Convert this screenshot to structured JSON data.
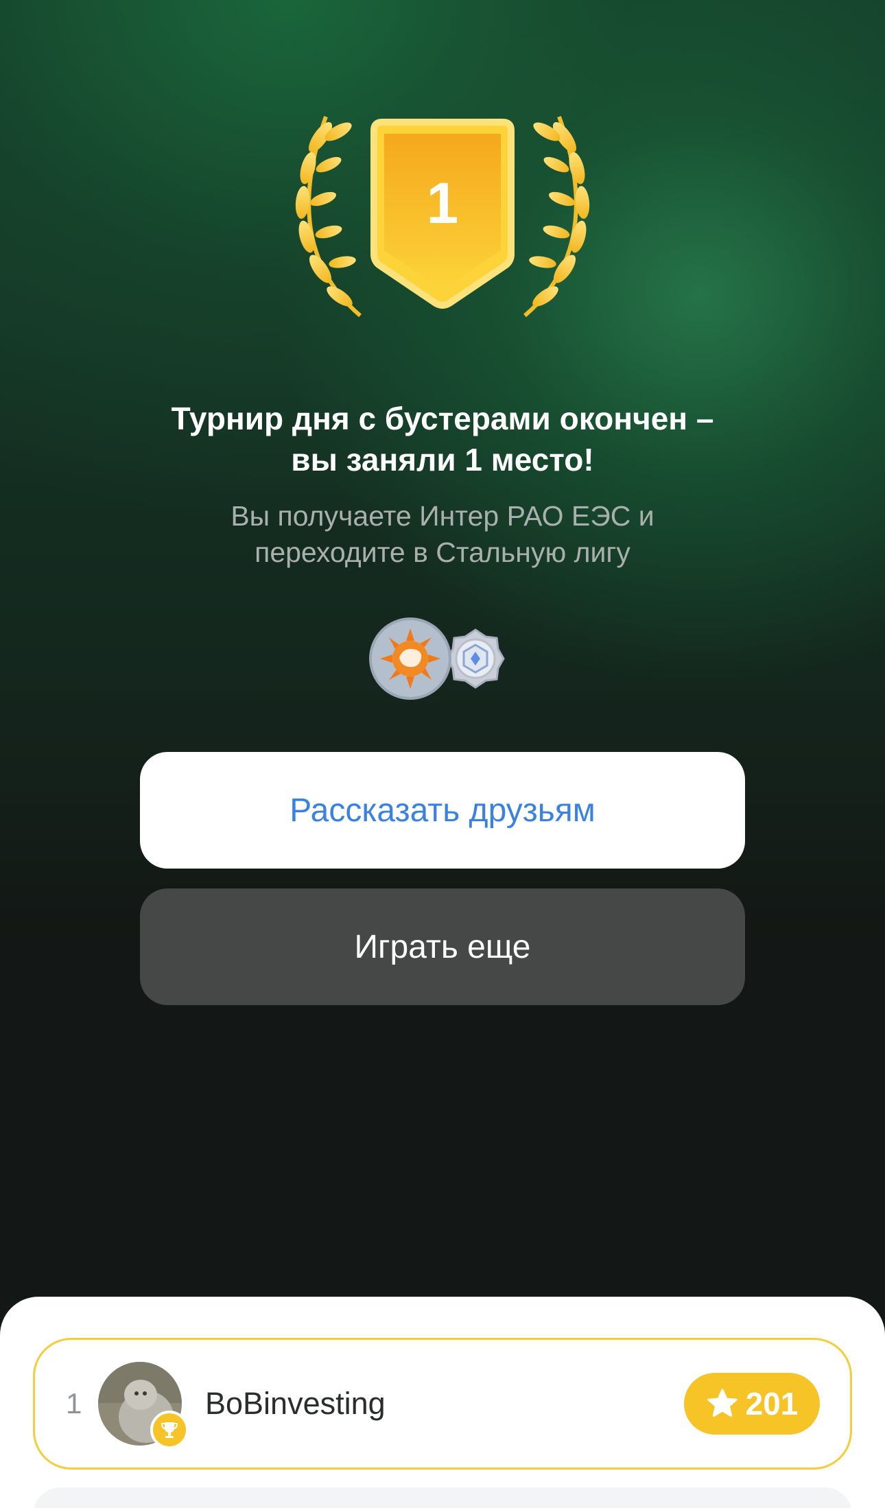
{
  "result": {
    "place_number": "1",
    "title_line1": "Турнир дня с бустерами окончен –",
    "title_line2": "вы заняли 1 место!",
    "subtitle_line1": "Вы получаете Интер РАО ЕЭС и",
    "subtitle_line2": "переходите в Стальную лигу"
  },
  "rewards": {
    "company_icon": "inter-rao-logo-icon",
    "league_icon": "steel-league-badge-icon"
  },
  "actions": {
    "share_label": "Рассказать друзьям",
    "play_again_label": "Играть еще"
  },
  "leaderboard": {
    "rows": [
      {
        "rank": "1",
        "username": "BoBinvesting",
        "score": "201",
        "badge_icon": "trophy-icon",
        "score_icon": "star-icon"
      }
    ]
  },
  "colors": {
    "gold": "#f6c426",
    "share_text": "#3b82e0",
    "play_button": "#454847",
    "highlight_border": "#f4cd3d"
  }
}
